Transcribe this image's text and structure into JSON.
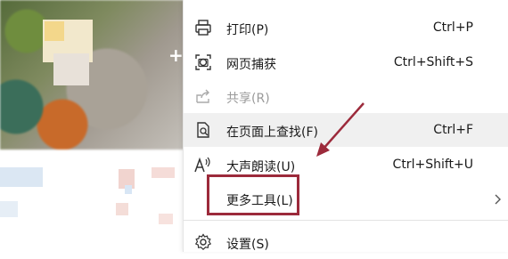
{
  "menu": {
    "items": [
      {
        "label": "打印(P)",
        "shortcut": "Ctrl+P",
        "icon": "printer-icon"
      },
      {
        "label": "网页捕获",
        "shortcut": "Ctrl+Shift+S",
        "icon": "screenshot-icon"
      },
      {
        "label": "共享(R)",
        "shortcut": "",
        "icon": "share-icon",
        "disabled": true
      },
      {
        "label": "在页面上查找(F)",
        "shortcut": "Ctrl+F",
        "icon": "find-in-page-icon"
      },
      {
        "label": "大声朗读(U)",
        "shortcut": "Ctrl+Shift+U",
        "icon": "read-aloud-icon"
      },
      {
        "label": "更多工具(L)",
        "shortcut": "",
        "icon": "",
        "submenu": true
      },
      {
        "label": "设置(S)",
        "shortcut": "",
        "icon": "gear-icon"
      }
    ]
  },
  "annotation": {
    "color": "#9c2a3b"
  }
}
